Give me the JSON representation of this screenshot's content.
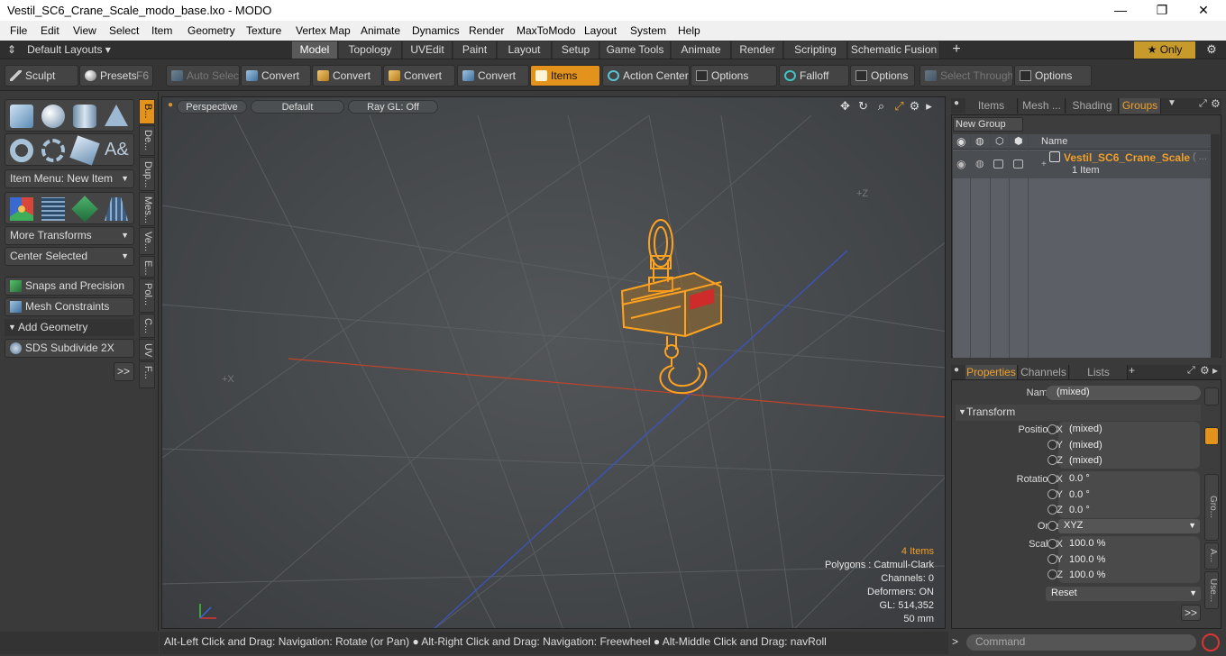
{
  "window": {
    "title": "Vestil_SC6_Crane_Scale_modo_base.lxo - MODO",
    "minimize": "—",
    "maximize": "❐",
    "close": "✕"
  },
  "menu": [
    "File",
    "Edit",
    "View",
    "Select",
    "Item",
    "Geometry",
    "Texture",
    "Vertex Map",
    "Animate",
    "Dynamics",
    "Render",
    "MaxToModo",
    "Layout",
    "System",
    "Help"
  ],
  "layout": {
    "dropdown": "Default Layouts ▾",
    "tabs": [
      "Model",
      "Topology",
      "UVEdit",
      "Paint",
      "Layout",
      "Setup",
      "Game Tools",
      "Animate",
      "Render",
      "Scripting",
      "Schematic Fusion"
    ],
    "active_tab": "Model",
    "add": "+",
    "only_label": "★  Only"
  },
  "toolstrip": {
    "sculpt": "Sculpt",
    "presets": "Presets",
    "presets_key": "F6",
    "auto_select": "Auto Select",
    "convert": "Convert",
    "items": "Items",
    "action_center": "Action Center",
    "options": "Options",
    "falloff": "Falloff",
    "select_through": "Select Through"
  },
  "left_toolbar": {
    "item_menu": "Item Menu: New Item",
    "more_transforms": "More Transforms",
    "center_selected": "Center Selected",
    "snaps": "Snaps and Precision",
    "mesh_constraints": "Mesh Constraints",
    "add_geometry": "Add Geometry",
    "sds": "SDS Subdivide 2X",
    "more": ">>",
    "vtabs": [
      "B...",
      "De...",
      "Dup...",
      "Mes...",
      "Ve...",
      "E...",
      "Pol...",
      "C...",
      "UV",
      "F..."
    ]
  },
  "viewport": {
    "perspective": "Perspective",
    "default": "Default",
    "raygl": "Ray GL: Off",
    "axis_z": "+Z",
    "axis_x": "+X",
    "info": {
      "items": "4 Items",
      "polygons": "Polygons : Catmull-Clark",
      "channels": "Channels: 0",
      "deformers": "Deformers: ON",
      "gl": "GL: 514,352",
      "scale": "50 mm"
    }
  },
  "groups_panel": {
    "tabs": [
      "Items",
      "Mesh ...",
      "Shading",
      "Groups"
    ],
    "active_tab": "Groups",
    "new_group": "New Group",
    "col_name": "Name",
    "row_name": "Vestil_SC6_Crane_Scale",
    "row_suffix": "( ...",
    "row_sub": "1 Item"
  },
  "properties": {
    "tabs": [
      "Properties",
      "Channels",
      "Lists"
    ],
    "add": "+",
    "name_label": "Name",
    "name_value": "(mixed)",
    "transform": "Transform",
    "position_label": "Position X",
    "y_label": "Y",
    "z_label": "Z",
    "position": [
      "(mixed)",
      "(mixed)",
      "(mixed)"
    ],
    "rotation_label": "Rotation X",
    "rotation": [
      "0.0 °",
      "0.0 °",
      "0.0 °"
    ],
    "order_label": "Order",
    "order_value": "XYZ",
    "scale_label": "Scale X",
    "scale": [
      "100.0 %",
      "100.0 %",
      "100.0 %"
    ],
    "reset": "Reset",
    "more": ">>",
    "side_tabs": [
      "Gro...",
      "A...",
      "Use..."
    ]
  },
  "status": {
    "hint": "Alt-Left Click and Drag: Navigation: Rotate (or Pan) ● Alt-Right Click and Drag: Navigation: Freewheel ● Alt-Middle Click and Drag: navRoll",
    "command_placeholder": "Command",
    "cmd_arrow": ">"
  },
  "colors": {
    "accent": "#e3931c",
    "model_wire": "#ffa21f",
    "x_axis": "#c0432b",
    "z_axis": "#3a55c8"
  }
}
